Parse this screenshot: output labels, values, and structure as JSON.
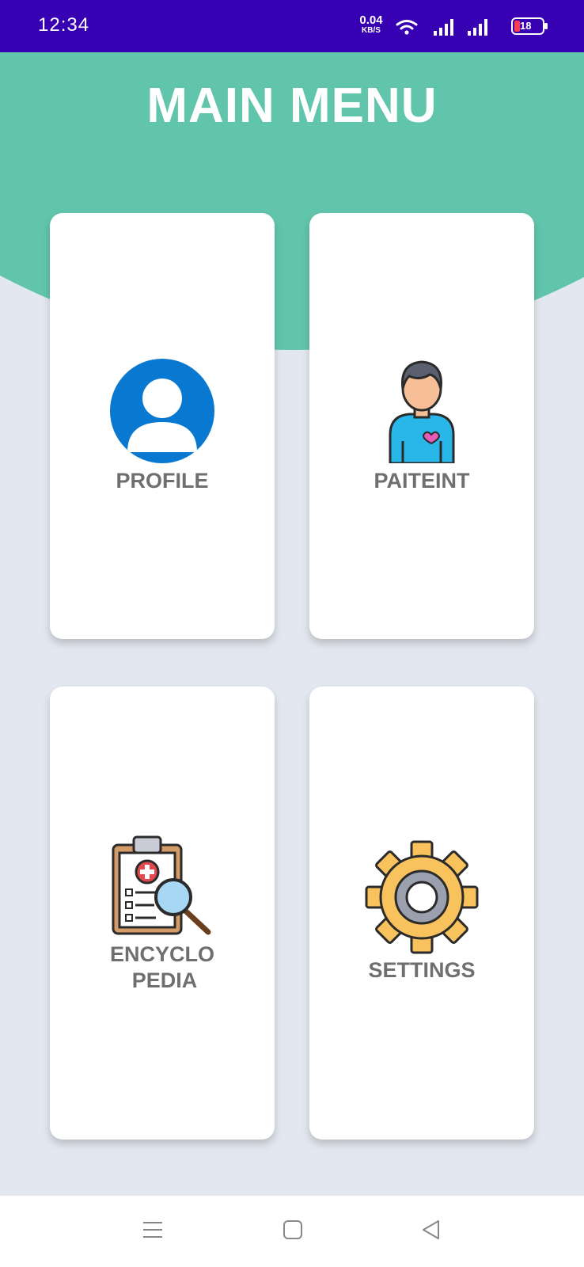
{
  "status_bar": {
    "time": "12:34",
    "net_speed_value": "0.04",
    "net_speed_unit": "KB/S",
    "battery_level": "18",
    "background_color": "#3700b3"
  },
  "header": {
    "title": "MAIN MENU",
    "background_color": "#61c5ac"
  },
  "menu": {
    "profile": {
      "label": "PROFILE",
      "icon": "user-avatar-icon"
    },
    "patient": {
      "label": "PAITEINT",
      "icon": "patient-person-icon"
    },
    "encyclopedia": {
      "label_line1": "ENCYCLO",
      "label_line2": "PEDIA",
      "icon": "clipboard-search-icon"
    },
    "settings": {
      "label": "SETTINGS",
      "icon": "gear-icon"
    }
  },
  "nav_bar": {
    "buttons": [
      "menu-icon",
      "home-icon",
      "back-icon"
    ]
  },
  "colors": {
    "page_background": "#e3e7ef",
    "card_background": "#ffffff",
    "label_color": "#6f6f6f",
    "accent_blue": "#0878d0",
    "gear_color": "#f8c25c"
  }
}
